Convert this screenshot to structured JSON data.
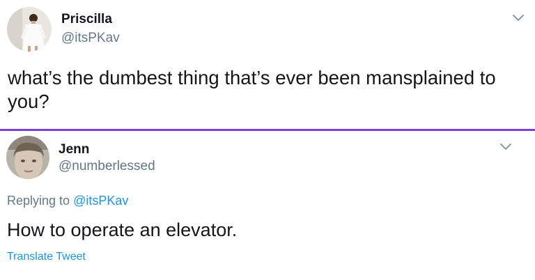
{
  "tweet": {
    "author_name": "Priscilla",
    "author_handle": "@itsPKav",
    "text": "what’s the dumbest thing that’s ever been mansplained to you?"
  },
  "reply": {
    "author_name": "Jenn",
    "author_handle": "@numberlessed",
    "replying_prefix": "Replying to",
    "replying_to": "@itsPKav",
    "text": "How to operate an elevator.",
    "translate_label": "Translate Tweet"
  },
  "colors": {
    "divider": "#7b3fd6",
    "link": "#1b95e0",
    "secondary_text": "#657786"
  },
  "icons": {
    "tweet_menu": "chevron-down-icon",
    "reply_menu": "chevron-down-icon"
  }
}
